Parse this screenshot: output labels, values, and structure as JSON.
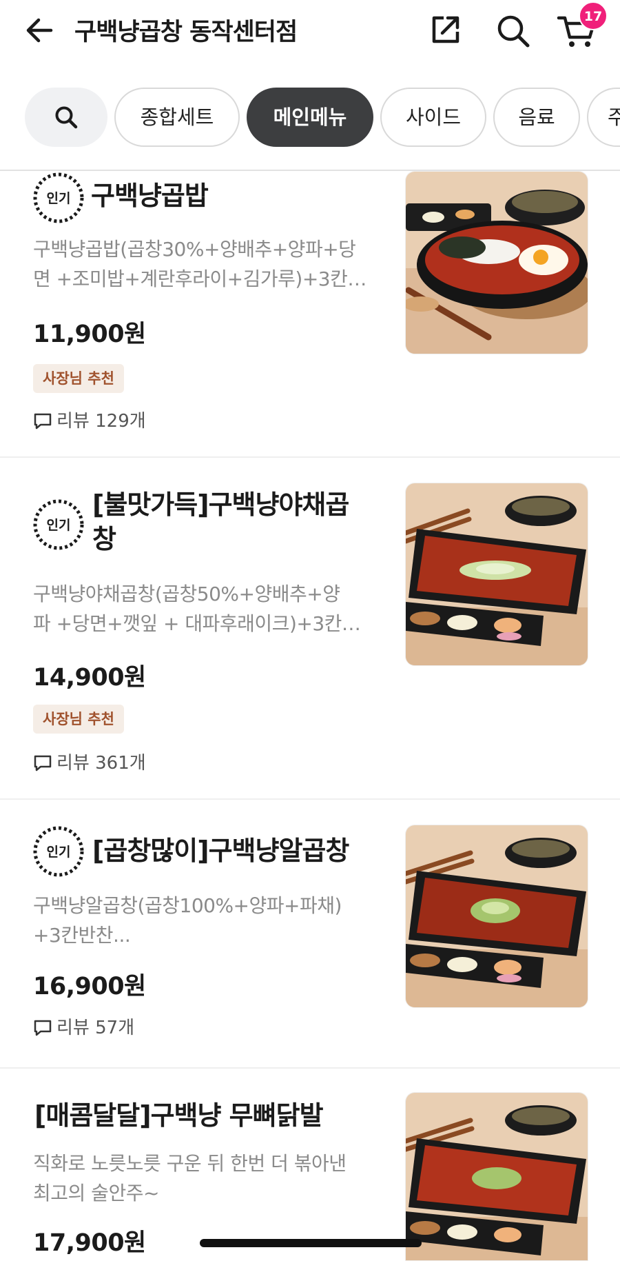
{
  "header": {
    "title": "구백냥곱창 동작센터점",
    "cart_count": "17",
    "icons": [
      "back-arrow-icon",
      "share-icon",
      "search-icon",
      "cart-icon"
    ]
  },
  "tabs": [
    {
      "label": "종합세트",
      "active": false
    },
    {
      "label": "메인메뉴",
      "active": true
    },
    {
      "label": "사이드",
      "active": false
    },
    {
      "label": "음료",
      "active": false
    },
    {
      "label": "주",
      "active": false
    }
  ],
  "hot_label": "인기",
  "items": [
    {
      "title": "구백냥곱밥",
      "hot": true,
      "desc1": "구백냥곱밥(곱창30%+양배추+양파+당",
      "desc2": "면 +조미밥+계란후라이+김가루)+3칸…",
      "price": "11,900원",
      "badge": "사장님 추천",
      "review": "리뷰 129개"
    },
    {
      "title1": "[불맛가득]구백냥야채곱",
      "title2": "창",
      "hot": true,
      "desc1": "구백냥야채곱창(곱창50%+양배추+양",
      "desc2": "파 +당면+깻잎 + 대파후래이크)+3칸…",
      "price": "14,900원",
      "badge": "사장님 추천",
      "review": "리뷰 361개"
    },
    {
      "title": "[곱창많이]구백냥알곱창",
      "hot": true,
      "desc1": "구백냥알곱창(곱창100%+양파+파채)",
      "desc2": "+3칸반찬...",
      "price": "16,900원",
      "review": "리뷰 57개"
    },
    {
      "title": "[매콤달달]구백냥 무뼈닭발",
      "hot": false,
      "desc1": "직화로 노릇노릇 구운 뒤 한번 더 볶아낸",
      "desc2": "최고의 술안주~",
      "price": "17,900원"
    }
  ],
  "colors": {
    "badge_pink": "#f0207a",
    "active_tab": "#3d3e40",
    "owner_badge_bg": "#f5ede6",
    "owner_badge_text": "#a0522d"
  }
}
